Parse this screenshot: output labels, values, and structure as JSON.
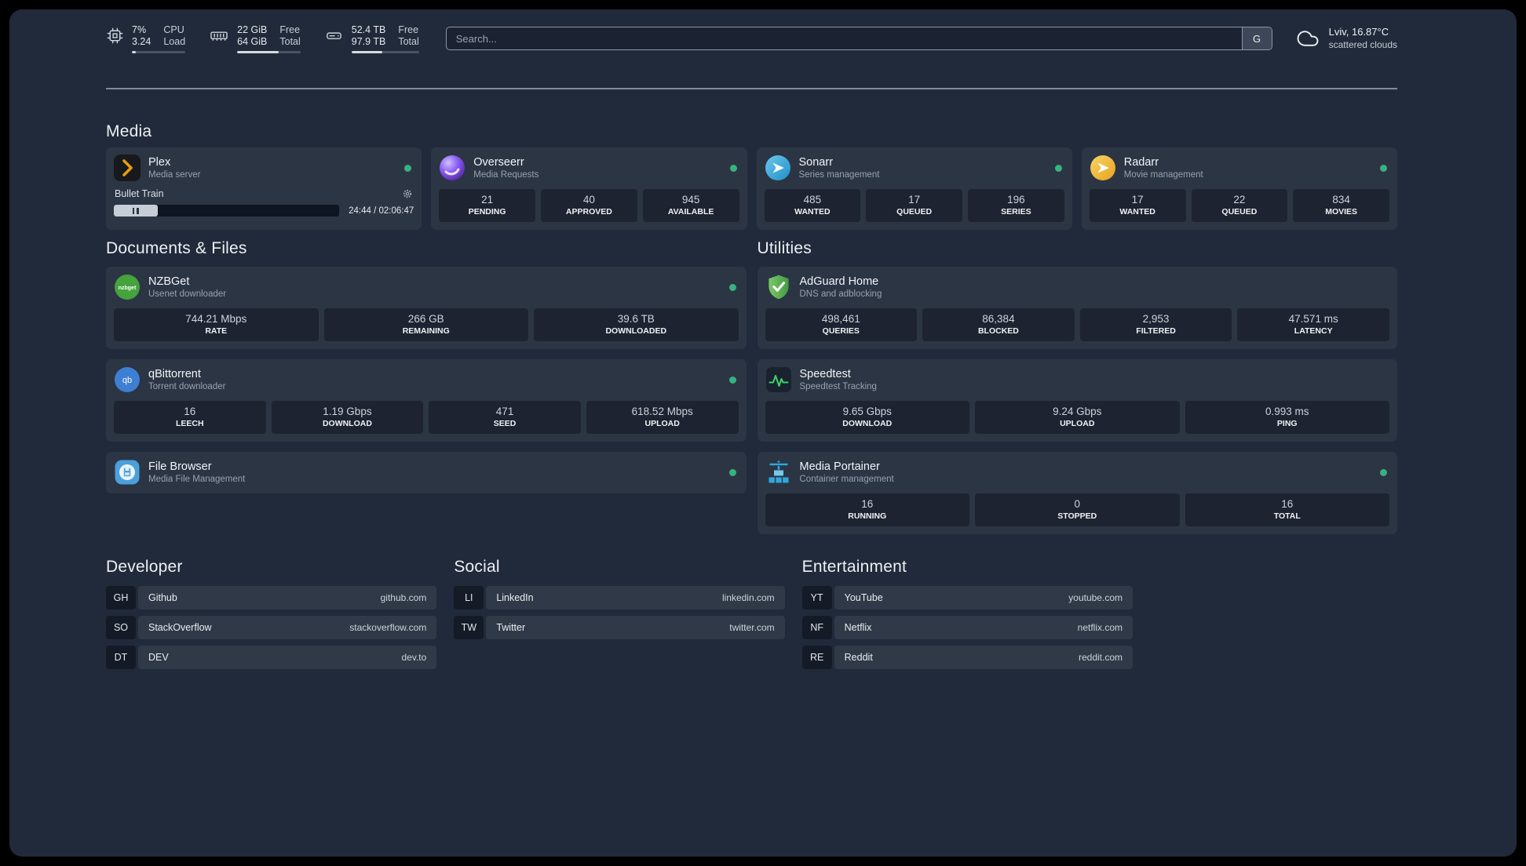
{
  "colors": {
    "background": "#202a3a",
    "status_online": "#36b37e",
    "plex_accent": "#e5a00d",
    "overseerr_purple": "#8b5cf6",
    "sonarr_blue": "#2da0d7",
    "radarr_amber": "#eeb03c",
    "nzbget_green": "#44a33c",
    "qbittorrent_blue": "#3d7fd3",
    "filebrowser_blue": "#4aa0dc",
    "adguard_green": "#5cb55a",
    "speedtest_green": "#3fd06a",
    "portainer_blue": "#2fa8dd"
  },
  "topbar": {
    "cpu": {
      "icon": "cpu-chip-icon",
      "percent": "7%",
      "load": "3.24",
      "label_top": "CPU",
      "label_bottom": "Load",
      "bar_percent": 7
    },
    "memory": {
      "icon": "memory-icon",
      "free": "22 GiB",
      "total": "64 GiB",
      "label_top": "Free",
      "label_bottom": "Total",
      "bar_percent": 66
    },
    "disk": {
      "icon": "hard-drive-icon",
      "free": "52.4 TB",
      "total": "97.9 TB",
      "label_top": "Free",
      "label_bottom": "Total",
      "bar_percent": 46
    },
    "search": {
      "placeholder": "Search...",
      "provider": "G"
    },
    "weather": {
      "icon": "cloud-icon",
      "location": "Lviv, 16.87°C",
      "condition": "scattered clouds"
    }
  },
  "media": {
    "title": "Media",
    "plex": {
      "icon": "plex-icon",
      "name": "Plex",
      "desc": "Media server",
      "status": "online",
      "now_playing": "Bullet Train",
      "time": "24:44 / 02:06:47",
      "progress_percent": 19.5
    },
    "overseerr": {
      "icon": "overseerr-icon",
      "name": "Overseerr",
      "desc": "Media Requests",
      "status": "online",
      "stats": [
        {
          "value": "21",
          "label": "PENDING"
        },
        {
          "value": "40",
          "label": "APPROVED"
        },
        {
          "value": "945",
          "label": "AVAILABLE"
        }
      ]
    },
    "sonarr": {
      "icon": "sonarr-icon",
      "name": "Sonarr",
      "desc": "Series management",
      "status": "online",
      "stats": [
        {
          "value": "485",
          "label": "WANTED"
        },
        {
          "value": "17",
          "label": "QUEUED"
        },
        {
          "value": "196",
          "label": "SERIES"
        }
      ]
    },
    "radarr": {
      "icon": "radarr-icon",
      "name": "Radarr",
      "desc": "Movie management",
      "status": "online",
      "stats": [
        {
          "value": "17",
          "label": "WANTED"
        },
        {
          "value": "22",
          "label": "QUEUED"
        },
        {
          "value": "834",
          "label": "MOVIES"
        }
      ]
    }
  },
  "documents": {
    "title": "Documents & Files",
    "nzbget": {
      "icon": "nzbget-icon",
      "name": "NZBGet",
      "desc": "Usenet downloader",
      "status": "online",
      "stats": [
        {
          "value": "744.21 Mbps",
          "label": "RATE"
        },
        {
          "value": "266 GB",
          "label": "REMAINING"
        },
        {
          "value": "39.6 TB",
          "label": "DOWNLOADED"
        }
      ]
    },
    "qbittorrent": {
      "icon": "qbittorrent-icon",
      "name": "qBittorrent",
      "desc": "Torrent downloader",
      "status": "online",
      "stats": [
        {
          "value": "16",
          "label": "LEECH"
        },
        {
          "value": "1.19 Gbps",
          "label": "DOWNLOAD"
        },
        {
          "value": "471",
          "label": "SEED"
        },
        {
          "value": "618.52 Mbps",
          "label": "UPLOAD"
        }
      ]
    },
    "filebrowser": {
      "icon": "filebrowser-icon",
      "name": "File Browser",
      "desc": "Media File Management",
      "status": "online"
    }
  },
  "utilities": {
    "title": "Utilities",
    "adguard": {
      "icon": "adguard-shield-icon",
      "name": "AdGuard Home",
      "desc": "DNS and adblocking",
      "stats": [
        {
          "value": "498,461",
          "label": "QUERIES"
        },
        {
          "value": "86,384",
          "label": "BLOCKED"
        },
        {
          "value": "2,953",
          "label": "FILTERED"
        },
        {
          "value": "47.571 ms",
          "label": "LATENCY"
        }
      ]
    },
    "speedtest": {
      "icon": "speedtest-graph-icon",
      "name": "Speedtest",
      "desc": "Speedtest Tracking",
      "stats": [
        {
          "value": "9.65 Gbps",
          "label": "DOWNLOAD"
        },
        {
          "value": "9.24 Gbps",
          "label": "UPLOAD"
        },
        {
          "value": "0.993 ms",
          "label": "PING"
        }
      ]
    },
    "portainer": {
      "icon": "portainer-crane-icon",
      "name": "Media Portainer",
      "desc": "Container management",
      "status": "online",
      "stats": [
        {
          "value": "16",
          "label": "RUNNING"
        },
        {
          "value": "0",
          "label": "STOPPED"
        },
        {
          "value": "16",
          "label": "TOTAL"
        }
      ]
    }
  },
  "bookmarks": {
    "developer": {
      "title": "Developer",
      "items": [
        {
          "abbr": "GH",
          "name": "Github",
          "url": "github.com"
        },
        {
          "abbr": "SO",
          "name": "StackOverflow",
          "url": "stackoverflow.com"
        },
        {
          "abbr": "DT",
          "name": "DEV",
          "url": "dev.to"
        }
      ]
    },
    "social": {
      "title": "Social",
      "items": [
        {
          "abbr": "LI",
          "name": "LinkedIn",
          "url": "linkedin.com"
        },
        {
          "abbr": "TW",
          "name": "Twitter",
          "url": "twitter.com"
        }
      ]
    },
    "entertainment": {
      "title": "Entertainment",
      "items": [
        {
          "abbr": "YT",
          "name": "YouTube",
          "url": "youtube.com"
        },
        {
          "abbr": "NF",
          "name": "Netflix",
          "url": "netflix.com"
        },
        {
          "abbr": "RE",
          "name": "Reddit",
          "url": "reddit.com"
        }
      ]
    }
  }
}
